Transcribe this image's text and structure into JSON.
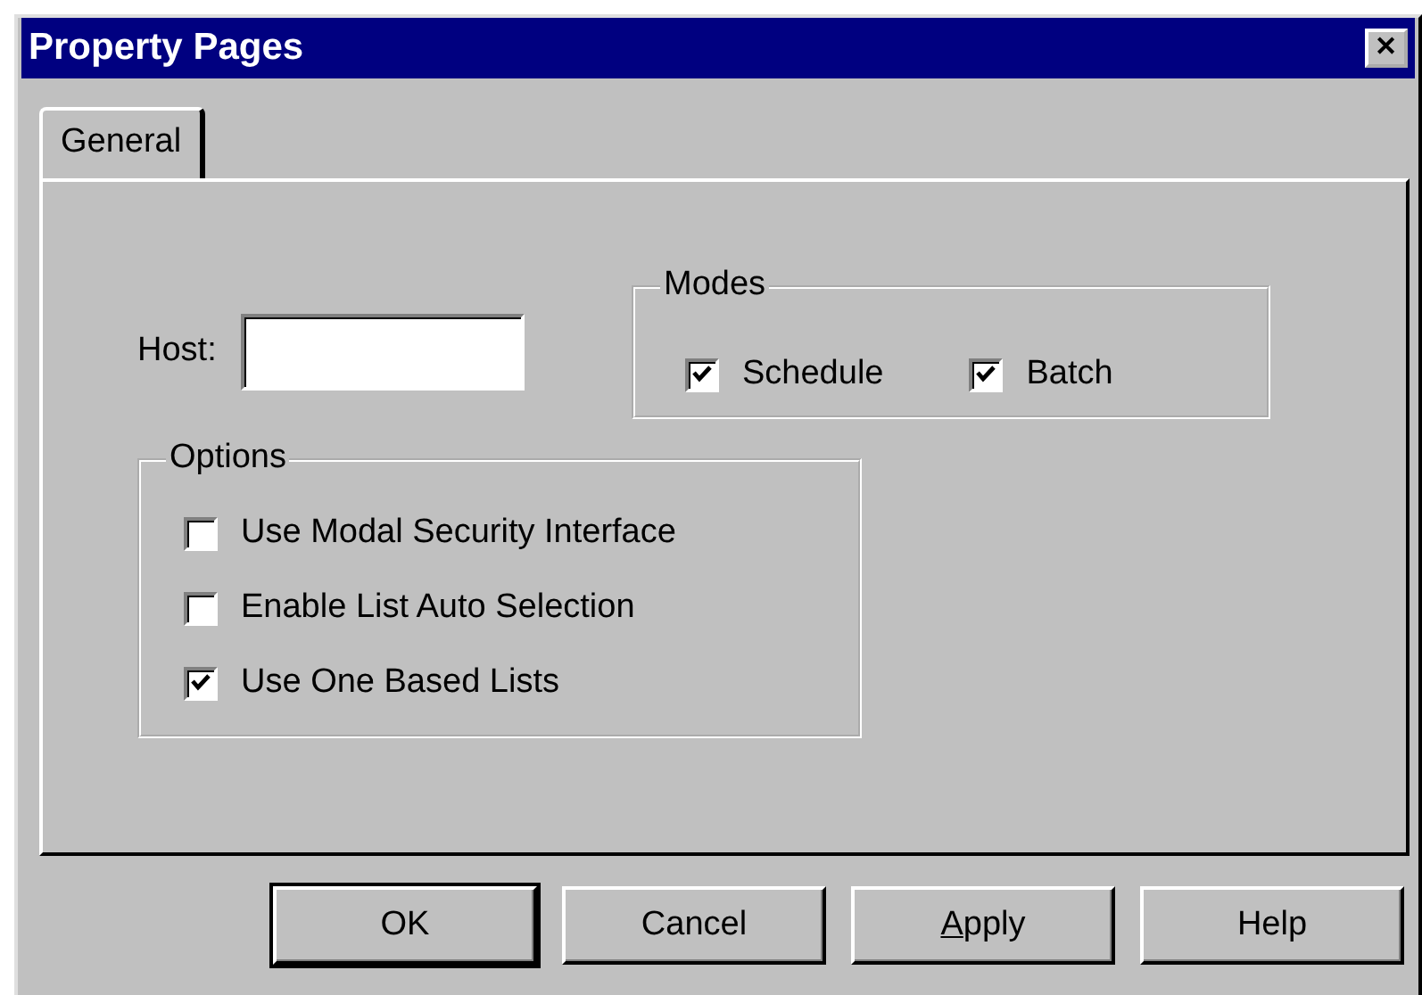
{
  "window": {
    "title": "Property Pages",
    "close": "✕"
  },
  "tabs": [
    {
      "label": "General",
      "selected": true
    }
  ],
  "host": {
    "label": "Host:"
  },
  "modes": {
    "title": "Modes",
    "items": [
      {
        "label": "Schedule",
        "checked": true
      },
      {
        "label": "Batch",
        "checked": true
      }
    ]
  },
  "options": {
    "title": "Options",
    "items": [
      {
        "label": "Use Modal Security Interface",
        "checked": false
      },
      {
        "label": "Enable List Auto Selection",
        "checked": false
      },
      {
        "label": "Use One Based Lists",
        "checked": true
      }
    ]
  },
  "buttons": [
    {
      "label": "OK",
      "default": true,
      "mnemonic": false
    },
    {
      "label": "Cancel",
      "default": false,
      "mnemonic": false
    },
    {
      "label": "Apply",
      "default": false,
      "mnemonic": true
    },
    {
      "label": "Help",
      "default": false,
      "mnemonic": false
    }
  ]
}
